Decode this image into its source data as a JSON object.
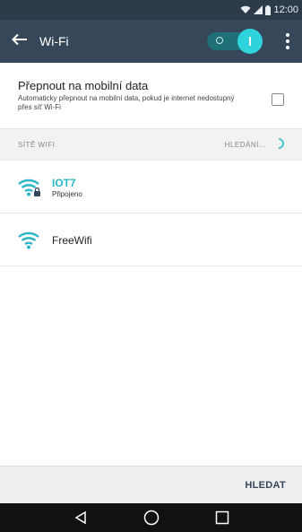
{
  "status_bar": {
    "time": "12:00",
    "icons": [
      "wifi-signal-icon",
      "cell-signal-icon",
      "battery-icon"
    ]
  },
  "app_bar": {
    "title": "Wi-Fi",
    "back_icon": "arrow-left-icon",
    "toggle_state": "on",
    "more_icon": "more-vert-icon"
  },
  "mobile_data": {
    "title": "Přepnout na mobilní data",
    "description": "Automaticky přepnout na mobilní data, pokud je internet nedostupný přes síť Wi-Fi",
    "checked": false
  },
  "networks_section": {
    "label": "SÍTĚ WIFI",
    "search_status": "HLEDÁNÍ..."
  },
  "networks": [
    {
      "name": "IOT7",
      "status": "Připojeno",
      "connected": true,
      "secured": true
    },
    {
      "name": "FreeWifi",
      "status": "",
      "connected": false,
      "secured": false
    }
  ],
  "bottom_bar": {
    "action_label": "HLEDAT"
  },
  "nav_bar": {
    "icons": [
      "back-triangle-icon",
      "home-circle-icon",
      "recents-square-icon"
    ]
  },
  "colors": {
    "app_bar": "#37475a",
    "status_bar": "#2c3a4a",
    "accent": "#2bb7c8",
    "toggle_knob": "#2ed3dc"
  }
}
